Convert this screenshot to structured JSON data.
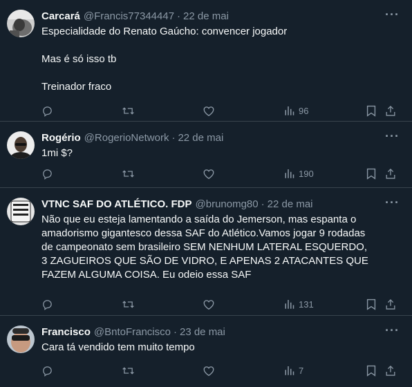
{
  "tweets": [
    {
      "name": "Carcará",
      "handle": "@Francis77344447",
      "date": "22 de mai",
      "paragraphs": [
        "Especialidade do Renato Gaúcho: convencer jogador",
        "Mas é só isso tb",
        "Treinador fraco"
      ],
      "views": "96",
      "avatar": "avatar-photo"
    },
    {
      "name": "Rogério",
      "handle": "@RogerioNetwork",
      "date": "22 de mai",
      "paragraphs": [
        "1mi $?"
      ],
      "views": "190",
      "avatar": "avatar-photo"
    },
    {
      "name": "VTNC SAF DO ATLÉTICO. FDP",
      "handle": "@brunomg80",
      "date": "22 de mai",
      "paragraphs": [
        "Não que eu esteja lamentando a saída do Jemerson, mas espanta o amadorismo gigantesco dessa SAF do Atlético.Vamos jogar 9 rodadas de campeonato sem brasileiro SEM NENHUM LATERAL ESQUERDO, 3 ZAGUEIROS QUE SÃO DE VIDRO, E APENAS 2 ATACANTES QUE FAZEM ALGUMA COISA. Eu odeio essa SAF"
      ],
      "views": "131",
      "avatar": "avatar-photo"
    },
    {
      "name": "Francisco",
      "handle": "@BntoFrancisco",
      "date": "23 de mai",
      "paragraphs": [
        "Cara tá vendido tem muito tempo"
      ],
      "views": "7",
      "avatar": "avatar-photo"
    }
  ],
  "separator": "·",
  "more_icon": "···",
  "colors": {
    "background": "#15202b",
    "text": "#f7f9f9",
    "secondary": "#8b98a5",
    "border": "#38444d"
  }
}
